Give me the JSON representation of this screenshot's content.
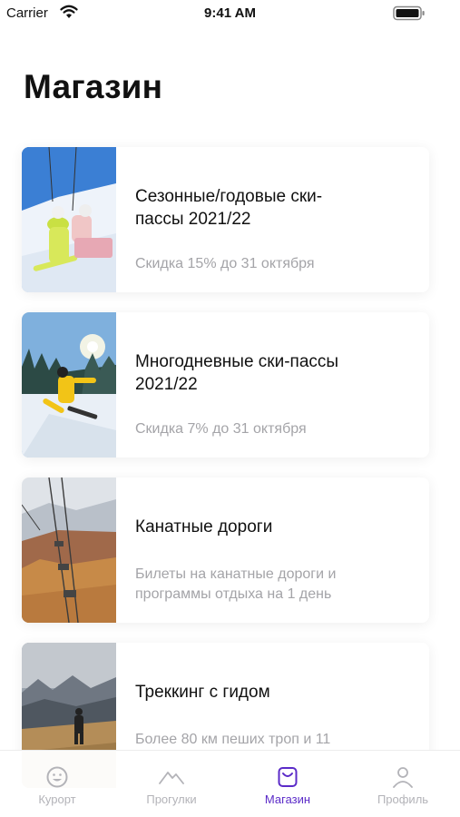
{
  "status_bar": {
    "carrier": "Carrier",
    "time": "9:41 AM"
  },
  "page": {
    "title": "Магазин"
  },
  "cards": [
    {
      "title_line1": "Сезонные/годовые ски-",
      "title_line2": "пассы 2021/22",
      "subtitle_line1": "Скидка 15% до 31 октября",
      "subtitle_line2": ""
    },
    {
      "title_line1": "Многодневные ски-пассы",
      "title_line2": "2021/22",
      "subtitle_line1": "Скидка 7% до 31 октября",
      "subtitle_line2": ""
    },
    {
      "title_line1": "Канатные дороги",
      "title_line2": "",
      "subtitle_line1": "Билеты на канатные дороги и",
      "subtitle_line2": "программы отдыха на 1 день"
    },
    {
      "title_line1": "Треккинг с гидом",
      "title_line2": "",
      "subtitle_line1": "Более 80 км пеших троп и 11",
      "subtitle_line2": ""
    }
  ],
  "tab_bar": {
    "tabs": [
      {
        "label": "Курорт",
        "icon": "smiley-icon",
        "active": false
      },
      {
        "label": "Прогулки",
        "icon": "mountain-icon",
        "active": false
      },
      {
        "label": "Магазин",
        "icon": "shopping-bag-icon",
        "active": true
      },
      {
        "label": "Профиль",
        "icon": "person-icon",
        "active": false
      }
    ]
  },
  "colors": {
    "accent": "#5b2bc8",
    "inactive_tab": "#b3b3b8",
    "subtitle": "#a4a4a8",
    "title": "#111111"
  }
}
